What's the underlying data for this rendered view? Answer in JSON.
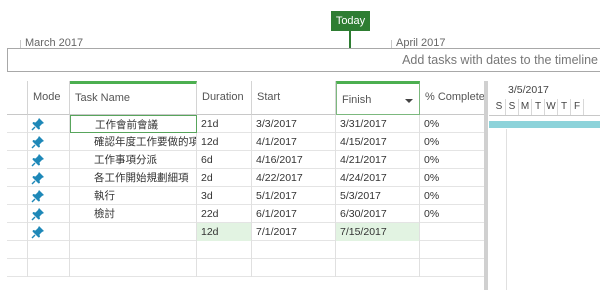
{
  "timeline": {
    "today_label": "Today",
    "months": [
      "March 2017",
      "April 2017"
    ],
    "placeholder": "Add tasks with dates to the timeline"
  },
  "columns": {
    "mode": "Mode",
    "task_name": "Task Name",
    "duration": "Duration",
    "start": "Start",
    "finish": "Finish",
    "complete": "% Complete"
  },
  "tasks": [
    {
      "name": "工作會前會議",
      "duration": "21d",
      "start": "3/3/2017",
      "finish": "3/31/2017",
      "complete": "0%"
    },
    {
      "name": "確認年度工作要做的項目",
      "duration": "12d",
      "start": "4/1/2017",
      "finish": "4/15/2017",
      "complete": "0%"
    },
    {
      "name": "工作事項分派",
      "duration": "6d",
      "start": "4/16/2017",
      "finish": "4/21/2017",
      "complete": "0%"
    },
    {
      "name": "各工作開始規劃細項",
      "duration": "2d",
      "start": "4/22/2017",
      "finish": "4/24/2017",
      "complete": "0%"
    },
    {
      "name": "執行",
      "duration": "3d",
      "start": "5/1/2017",
      "finish": "5/3/2017",
      "complete": "0%"
    },
    {
      "name": "檢討",
      "duration": "22d",
      "start": "6/1/2017",
      "finish": "6/30/2017",
      "complete": "0%"
    },
    {
      "name": "",
      "duration": "12d",
      "start": "7/1/2017",
      "finish": "7/15/2017",
      "complete": ""
    }
  ],
  "chart": {
    "date": "3/5/2017",
    "days": [
      "S",
      "S",
      "M",
      "T",
      "W",
      "T",
      "F"
    ]
  },
  "colors": {
    "accent": "#2e7d32",
    "summary_bar": "#8dd3da",
    "highlight": "#e2f3e2",
    "pin": "#1e88b8"
  }
}
